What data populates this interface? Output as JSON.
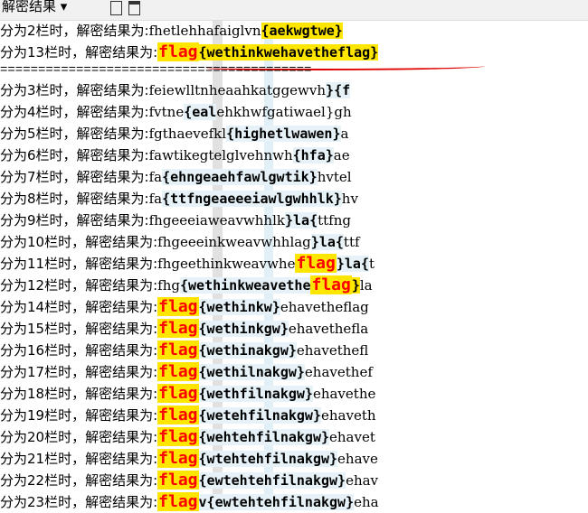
{
  "toolbar": {
    "title": "解密结果 ▾",
    "icons": [
      "document-icon",
      "save-icon"
    ]
  },
  "prefix_label": "解密结果为:",
  "lines": [
    {
      "cols": "分为2栏时，",
      "text": "fhetlehhafaiglvn",
      "brace": "{aekwgtwe}",
      "flag": "",
      "after": ""
    },
    {
      "cols": "分为13栏时，",
      "text": "",
      "flag": "flag",
      "brace": "{wethinkwehavetheflag}",
      "after": ""
    },
    {
      "sep": "========================================="
    },
    {
      "cols": "分为3栏时，",
      "text": "feiewlltnheaahkatggewvh",
      "brace": "}{f",
      "after": ""
    },
    {
      "cols": "分为4栏时，",
      "text": "fvtne",
      "brace": "{eal",
      "after": "ehkhwfgatiwael}gh"
    },
    {
      "cols": "分为5栏时，",
      "text": "fgthaevefkl",
      "brace": "{highetlwawen}",
      "after": "a"
    },
    {
      "cols": "分为6栏时，",
      "text": "fawtikegtelglvehnwh",
      "brace": "{hfa}",
      "after": "ae"
    },
    {
      "cols": "分为7栏时，",
      "text": "fa",
      "brace": "{ehngeaehfawlgwtik}",
      "after": "hvtel"
    },
    {
      "cols": "分为8栏时，",
      "text": "fa",
      "brace": "{ttfngeaeeeiawlgwhhlk}",
      "after": "hv"
    },
    {
      "cols": "分为9栏时，",
      "text": "fhgeeeiaweavwhhlk",
      "brace": "}la{",
      "after": "ttfng"
    },
    {
      "cols": "分为10栏时，",
      "text": "fhgeeeinkweavwhhlag",
      "brace": "}la{",
      "after": "ttf"
    },
    {
      "cols": "分为11栏时，",
      "text": "fhgeethinkweavwhe",
      "flag": "flag",
      "brace": "}la{",
      "after": "t"
    },
    {
      "cols": "分为12栏时，",
      "text": "fhg",
      "brace": "{wethinkweavethe",
      "flag": "flag",
      "brace2": "}",
      "after": "la"
    },
    {
      "cols": "分为14栏时，",
      "flag": "flag",
      "brace": "{wethinkw}",
      "after": "ehavetheflag"
    },
    {
      "cols": "分为15栏时，",
      "flag": "flag",
      "brace": "{wethinkgw}",
      "after": "ehavethefla"
    },
    {
      "cols": "分为16栏时，",
      "flag": "flag",
      "brace": "{wethinakgw}",
      "after": "ehavethefl"
    },
    {
      "cols": "分为17栏时，",
      "flag": "flag",
      "brace": "{wethilnakgw}",
      "after": "ehavethef"
    },
    {
      "cols": "分为18栏时，",
      "flag": "flag",
      "brace": "{wethfilnakgw}",
      "after": "ehavethe"
    },
    {
      "cols": "分为19栏时，",
      "flag": "flag",
      "brace": "{wetehfilnakgw}",
      "after": "ehaveth"
    },
    {
      "cols": "分为20栏时，",
      "flag": "flag",
      "brace": "{wehtehfilnakgw}",
      "after": "ehavet"
    },
    {
      "cols": "分为21栏时，",
      "flag": "flag",
      "brace": "{wtehtehfilnakgw}",
      "after": "ehave"
    },
    {
      "cols": "分为22栏时，",
      "flag": "flag",
      "brace": "{ewtehtehfilnakgw}",
      "after": "ehav"
    },
    {
      "cols": "分为23栏时，",
      "flag": "flag",
      "brace": "v{ewtehtehfilnakgw}",
      "after": "eha"
    }
  ]
}
